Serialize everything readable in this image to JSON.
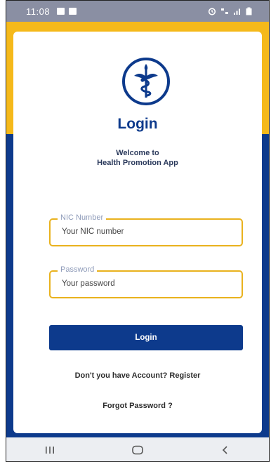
{
  "status_bar": {
    "time": "11:08",
    "left_icons": [
      "image-icon",
      "check-box-icon"
    ],
    "right_icons": [
      "alarm-icon",
      "network-icon",
      "signal-icon",
      "battery-icon"
    ]
  },
  "login": {
    "title": "Login",
    "welcome_line1": "Welcome to",
    "welcome_line2": "Health Promotion App",
    "nic_label": "NIC Number",
    "nic_placeholder": "Your NIC number",
    "password_label": "Password",
    "password_placeholder": "Your password",
    "login_button": "Login",
    "register_link": "Don't you have Account? Register",
    "forgot_link": "Forgot Password ?"
  },
  "nav_bar": {
    "items": [
      "recent-apps-icon",
      "home-icon",
      "back-icon"
    ]
  },
  "colors": {
    "brand_navy": "#0d3a8c",
    "brand_yellow": "#f5b91a",
    "field_border": "#e9b21e"
  }
}
